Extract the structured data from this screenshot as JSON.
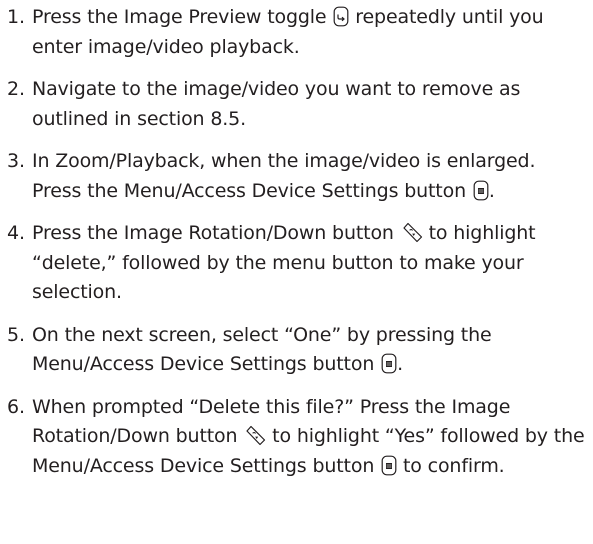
{
  "steps": [
    {
      "num": "1.",
      "parts": [
        "Press the Image Preview toggle ",
        " repeatedly until you enter image/video playback."
      ],
      "icons": [
        "image-preview-icon"
      ]
    },
    {
      "num": "2.",
      "parts": [
        "Navigate to the image/video you want to remove as outlined in section 8.5."
      ],
      "icons": []
    },
    {
      "num": "3.",
      "parts": [
        "In Zoom/Playback, when the image/video is enlarged. Press the Menu/Access Device Settings button ",
        "."
      ],
      "icons": [
        "menu-button-icon"
      ]
    },
    {
      "num": "4.",
      "parts": [
        "Press the Image Rotation/Down button ",
        " to highlight “delete,” followed by the menu button to make your selection."
      ],
      "icons": [
        "image-rotation-down-icon"
      ]
    },
    {
      "num": "5.",
      "parts": [
        "On the next screen, select “One” by pressing the Menu/Access Device Settings button ",
        "."
      ],
      "icons": [
        "menu-button-icon"
      ]
    },
    {
      "num": "6.",
      "parts": [
        "When prompted “Delete this file?” Press the Image Rotation/Down button ",
        " to highlight “Yes” followed by the Menu/Access Device Settings button ",
        " to confirm."
      ],
      "icons": [
        "image-rotation-down-icon",
        "menu-button-icon"
      ]
    }
  ]
}
